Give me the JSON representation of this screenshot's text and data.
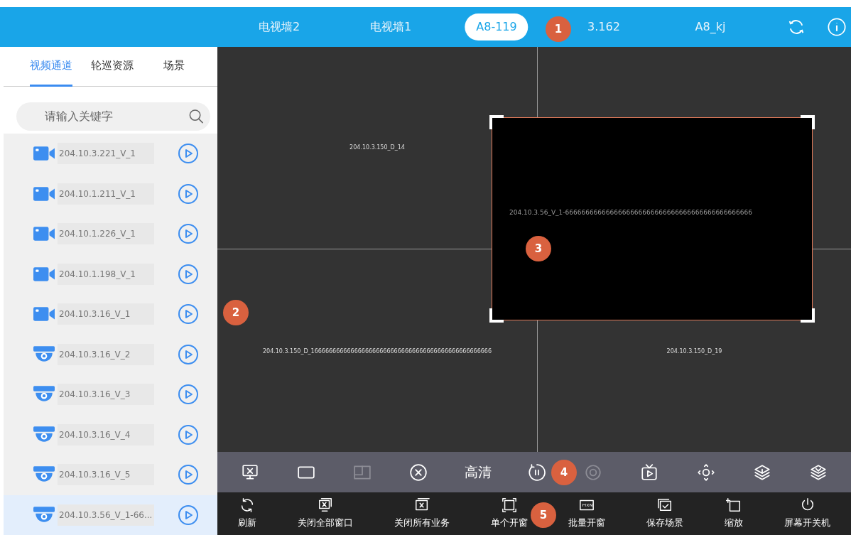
{
  "top_tabs": [
    {
      "label": "电视墙2",
      "selected": false
    },
    {
      "label": "电视墙1",
      "selected": false
    },
    {
      "label": "A8-119",
      "selected": true
    },
    {
      "label": "3.162",
      "selected": false
    },
    {
      "label": "A8_kj",
      "selected": false
    }
  ],
  "sidebar": {
    "tabs": [
      {
        "label": "视频通道",
        "selected": true
      },
      {
        "label": "轮巡资源",
        "selected": false
      },
      {
        "label": "场景",
        "selected": false
      }
    ],
    "search": {
      "placeholder": "请输入关键字"
    },
    "items": [
      {
        "kind": "bullet-camera",
        "label": "204.10.3.221_V_1",
        "selected": false
      },
      {
        "kind": "bullet-camera",
        "label": "204.10.1.211_V_1",
        "selected": false
      },
      {
        "kind": "bullet-camera",
        "label": "204.10.1.226_V_1",
        "selected": false
      },
      {
        "kind": "bullet-camera",
        "label": "204.10.1.198_V_1",
        "selected": false
      },
      {
        "kind": "bullet-camera",
        "label": "204.10.3.16_V_1",
        "selected": false
      },
      {
        "kind": "dome-camera",
        "label": "204.10.3.16_V_2",
        "selected": false
      },
      {
        "kind": "dome-camera",
        "label": "204.10.3.16_V_3",
        "selected": false
      },
      {
        "kind": "dome-camera",
        "label": "204.10.3.16_V_4",
        "selected": false
      },
      {
        "kind": "dome-camera",
        "label": "204.10.3.16_V_5",
        "selected": false
      },
      {
        "kind": "dome-camera",
        "label": "204.10.3.56_V_1-66...",
        "selected": true
      }
    ]
  },
  "wall": {
    "cells": [
      {
        "label": "204.10.3.150_D_14"
      },
      {},
      {
        "label": "204.10.3.150_D_16666666666666666666666666666666666666666666666666"
      },
      {
        "label": "204.10.3.150_D_19"
      }
    ],
    "window": {
      "label": "204.10.3.56_V_1-6666666666666666666666666666666666666666666666",
      "selected": true
    }
  },
  "toolbar": [
    {
      "kind": "close-screen",
      "disabled": false
    },
    {
      "kind": "rectangle",
      "disabled": false
    },
    {
      "kind": "split",
      "disabled": true
    },
    {
      "kind": "close-circle",
      "disabled": false
    },
    {
      "kind": "text",
      "label": "高清",
      "disabled": false
    },
    {
      "kind": "pause-circle",
      "disabled": false
    },
    {
      "kind": "record",
      "disabled": true
    },
    {
      "kind": "tv-play",
      "disabled": false
    },
    {
      "kind": "ptz",
      "disabled": false
    },
    {
      "kind": "layer-up",
      "disabled": false
    },
    {
      "kind": "layer-down",
      "disabled": false
    }
  ],
  "actions": [
    {
      "kind": "refresh",
      "label": "刷新"
    },
    {
      "kind": "close-all",
      "label": "关闭全部窗口"
    },
    {
      "kind": "close-business",
      "label": "关闭所有业务"
    },
    {
      "kind": "single",
      "label": "单个开窗"
    },
    {
      "kind": "batch",
      "label": "批量开窗"
    },
    {
      "kind": "save",
      "label": "保存场景"
    },
    {
      "kind": "zoom",
      "label": "缩放"
    },
    {
      "kind": "power",
      "label": "屏幕开关机"
    }
  ],
  "callouts": [
    "1",
    "2",
    "3",
    "4",
    "5"
  ]
}
